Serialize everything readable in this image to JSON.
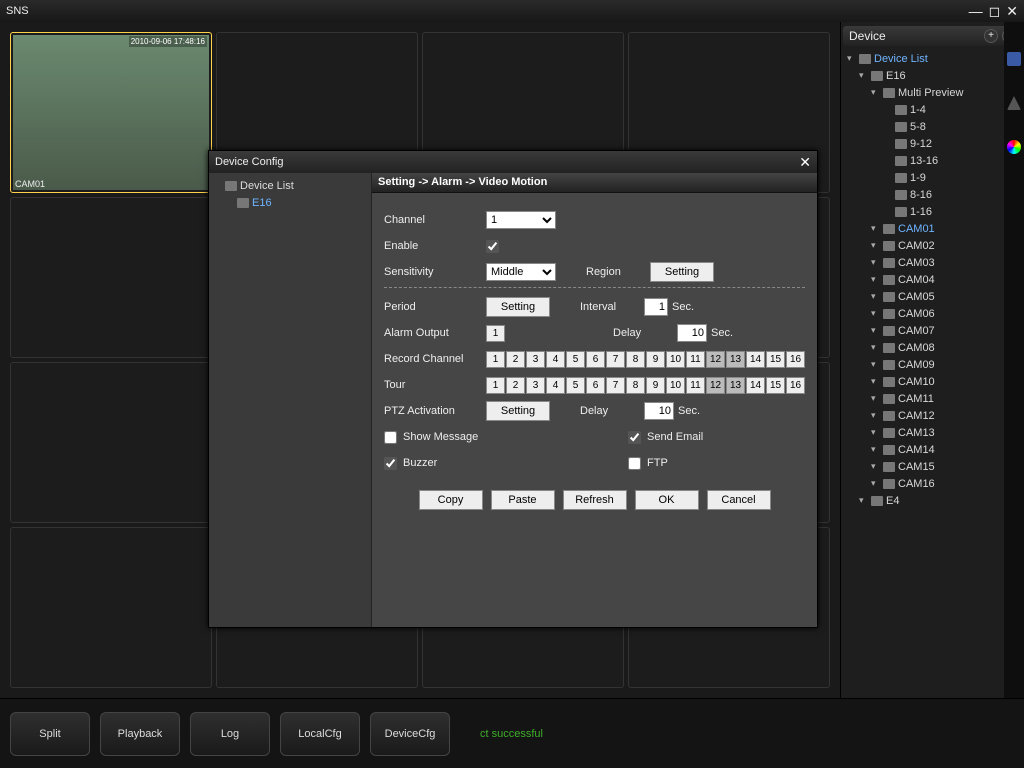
{
  "app": {
    "title": "SNS"
  },
  "grid": {
    "cam_label": "CAM01",
    "timestamp": "2010-09-06 17:48:16"
  },
  "side": {
    "header": "Device",
    "root": "Device List",
    "device": "E16",
    "multi": "Multi Preview",
    "ranges": [
      "1-4",
      "5-8",
      "9-12",
      "13-16",
      "1-9",
      "8-16",
      "1-16"
    ],
    "cams": [
      "CAM01",
      "CAM02",
      "CAM03",
      "CAM04",
      "CAM05",
      "CAM06",
      "CAM07",
      "CAM08",
      "CAM09",
      "CAM10",
      "CAM11",
      "CAM12",
      "CAM13",
      "CAM14",
      "CAM15",
      "CAM16"
    ],
    "device2": "E4"
  },
  "bottom": {
    "split": "Split",
    "playback": "Playback",
    "log": "Log",
    "localcfg": "LocalCfg",
    "devicecfg": "DeviceCfg",
    "status": "ct successful"
  },
  "dialog": {
    "title": "Device Config",
    "tree_root": "Device List",
    "tree_sel": "E16",
    "breadcrumb": "Setting -> Alarm -> Video Motion",
    "labels": {
      "channel": "Channel",
      "enable": "Enable",
      "sensitivity": "Sensitivity",
      "region": "Region",
      "period": "Period",
      "interval": "Interval",
      "alarm_output": "Alarm Output",
      "delay": "Delay",
      "record_channel": "Record Channel",
      "tour": "Tour",
      "ptz": "PTZ Activation",
      "show_message": "Show Message",
      "send_email": "Send Email",
      "buzzer": "Buzzer",
      "ftp": "FTP",
      "sec": "Sec.",
      "setting": "Setting"
    },
    "values": {
      "channel": "1",
      "sensitivity": "Middle",
      "interval": "1",
      "alarm_output": "1",
      "delay1": "10",
      "delay2": "10",
      "enable": true,
      "show_message": false,
      "send_email": true,
      "buzzer": true,
      "ftp": false
    },
    "channels": [
      "1",
      "2",
      "3",
      "4",
      "5",
      "6",
      "7",
      "8",
      "9",
      "10",
      "11",
      "12",
      "13",
      "14",
      "15",
      "16"
    ],
    "record_off": [
      12,
      13
    ],
    "tour_off": [
      12,
      13
    ],
    "buttons": {
      "copy": "Copy",
      "paste": "Paste",
      "refresh": "Refresh",
      "ok": "OK",
      "cancel": "Cancel"
    }
  }
}
